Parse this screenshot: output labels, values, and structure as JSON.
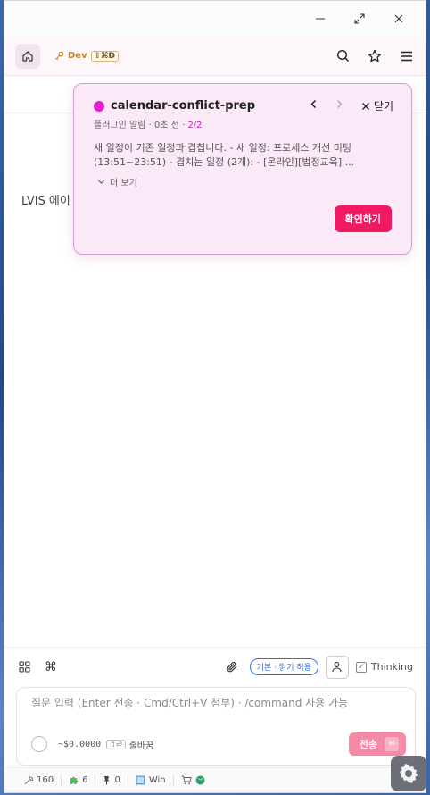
{
  "header": {
    "dev_label": "Dev",
    "dev_shortcut": "⇧⌘D"
  },
  "content": {
    "text": "LVIS 에이"
  },
  "popup": {
    "title": "calendar-conflict-prep",
    "source": "플러그인 알림",
    "time": "0초 전",
    "page": "2/2",
    "close_label": "닫기",
    "body": "새 일정이 기존 일정과 겹칩니다. - 새 일정: 프로세스 개선 미팅 (13:51~23:51) - 겹치는 일정 (2개): - [온라인][법정교육] ...",
    "more_label": "더 보기",
    "confirm_label": "확인하기",
    "dot_color": "#e41fd6"
  },
  "toolbar": {
    "permission_label": "기본 · 읽기 허용",
    "thinking_label": "Thinking"
  },
  "input": {
    "placeholder": "질문 입력 (Enter 전송 · Cmd/Ctrl+V 첨부) · /command 사용 가능",
    "cost": "~$0.0000",
    "wrap_shortcut": "⇧⏎",
    "wrap_label": "줄바꿈",
    "send_label": "전송",
    "send_shortcut": "⏎"
  },
  "status": {
    "tools_count": "160",
    "plugins_count": "6",
    "pins_count": "0",
    "platform": "Win"
  },
  "colors": {
    "accent": "#f01962",
    "send_disabled": "#f58aa6",
    "permission": "#2f6fe4"
  }
}
